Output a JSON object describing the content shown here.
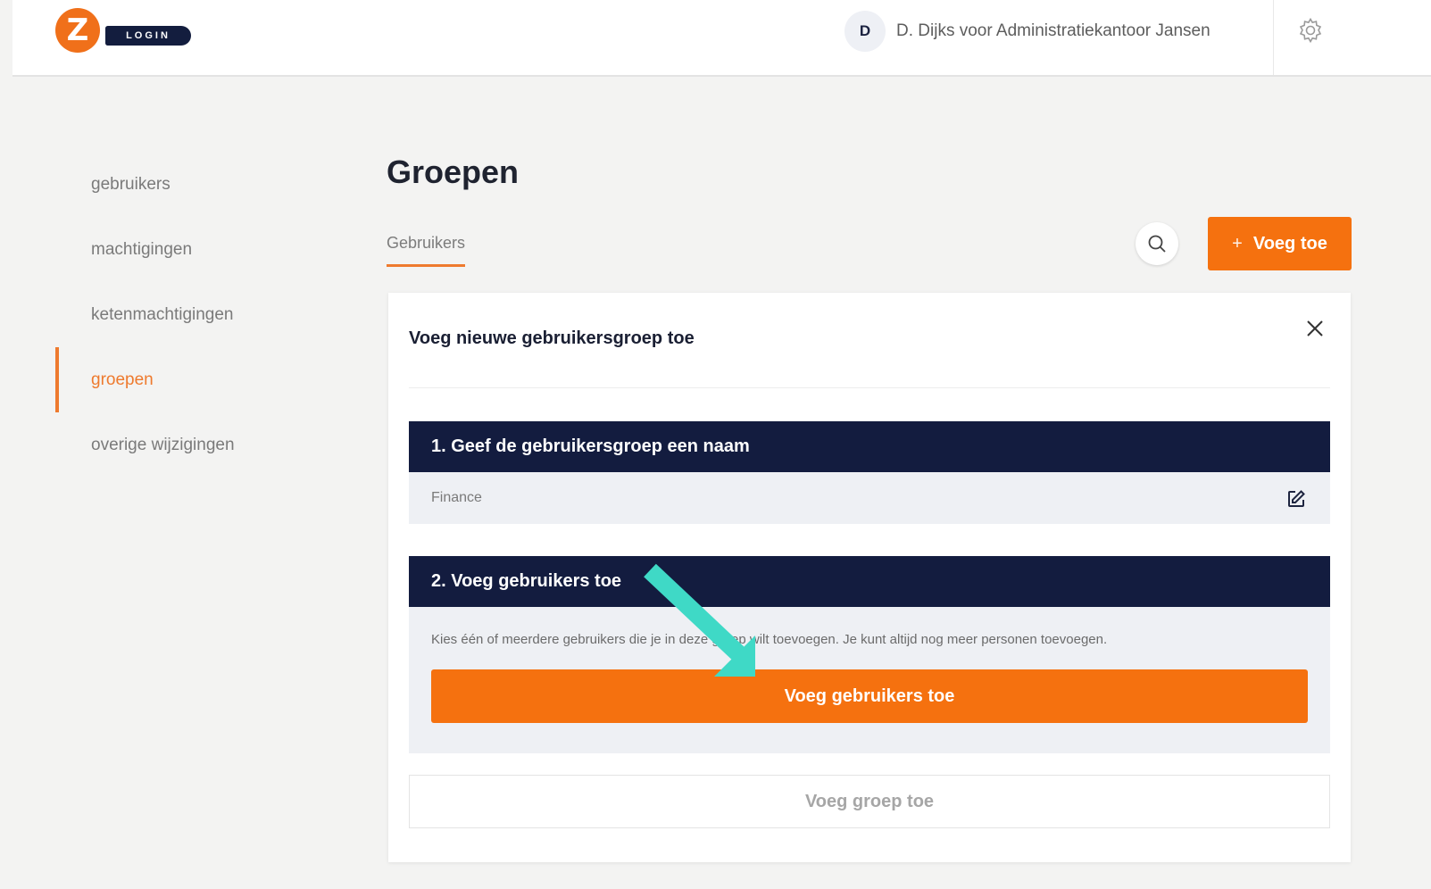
{
  "header": {
    "logo_letter": "Z",
    "logo_text": "LOGIN",
    "user_initial": "D",
    "user_name": "D. Dijks voor Administratiekantoor Jansen",
    "settings_icon": "gear-icon"
  },
  "sidebar": {
    "items": [
      {
        "label": "gebruikers",
        "active": false
      },
      {
        "label": "machtigingen",
        "active": false
      },
      {
        "label": "ketenmachtigingen",
        "active": false
      },
      {
        "label": "groepen",
        "active": true
      },
      {
        "label": "overige wijzigingen",
        "active": false
      }
    ]
  },
  "main": {
    "title": "Groepen",
    "tab_label": "Gebruikers",
    "search_icon": "search-icon",
    "add_button": {
      "icon": "+",
      "label": "Voeg toe"
    }
  },
  "panel": {
    "title": "Voeg nieuwe gebruikersgroep toe",
    "close_icon": "close-icon",
    "step1": {
      "heading": "1. Geef de gebruikersgroep een naam",
      "value": "Finance",
      "edit_icon": "edit-icon"
    },
    "step2": {
      "heading": "2. Voeg gebruikers toe",
      "description": "Kies één of meerdere gebruikers die je in deze groep wilt toevoegen. Je kunt altijd nog meer personen toevoegen.",
      "button_label": "Voeg gebruikers toe"
    },
    "submit_label": "Voeg groep toe"
  },
  "colors": {
    "accent": "#f5710f",
    "navy": "#131c3f",
    "annotation_arrow": "#3fd9c6"
  }
}
